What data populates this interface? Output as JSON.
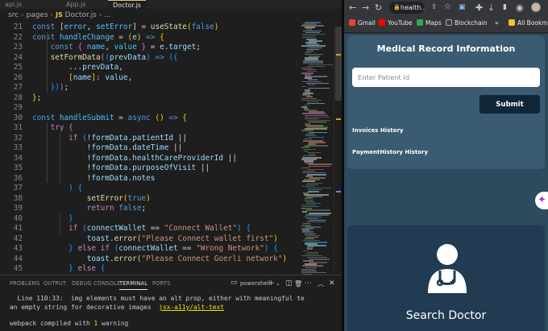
{
  "vscode": {
    "tabs": [
      "api.js",
      "App.js",
      "Doctor.js"
    ],
    "breadcrumb": {
      "parts": [
        "src",
        "pages",
        "Doctor.js"
      ],
      "tail": "..."
    },
    "code_lines": [
      {
        "n": "21",
        "tokens": [
          [
            "kw",
            "const "
          ],
          [
            "pu",
            "["
          ],
          [
            "cst",
            "error"
          ],
          [
            "pu",
            ", "
          ],
          [
            "cst",
            "setError"
          ],
          [
            "pu",
            "] = "
          ],
          [
            "fn",
            "useState"
          ],
          [
            "br1",
            "("
          ],
          [
            "kw",
            "false"
          ],
          [
            "br1",
            ")"
          ]
        ]
      },
      {
        "n": "22",
        "tokens": [
          [
            "kw",
            "const "
          ],
          [
            "cst",
            "handleChange"
          ],
          [
            "pu",
            " = "
          ],
          [
            "br1",
            "("
          ],
          [
            "var",
            "e"
          ],
          [
            "br1",
            ")"
          ],
          [
            "kw",
            " => "
          ],
          [
            "br1",
            "{"
          ]
        ]
      },
      {
        "n": "23",
        "tokens": [
          [
            "kw",
            "    const "
          ],
          [
            "br2",
            "{ "
          ],
          [
            "cst",
            "name"
          ],
          [
            "pu",
            ", "
          ],
          [
            "cst",
            "value"
          ],
          [
            "br2",
            " }"
          ],
          [
            "pu",
            " = "
          ],
          [
            "var",
            "e"
          ],
          [
            "pu",
            "."
          ],
          [
            "var",
            "target"
          ],
          [
            "pu",
            ";"
          ]
        ]
      },
      {
        "n": "24",
        "tokens": [
          [
            "fn",
            "    setFormData"
          ],
          [
            "br2",
            "("
          ],
          [
            "br3",
            "("
          ],
          [
            "var",
            "prevData"
          ],
          [
            "br3",
            ")"
          ],
          [
            "kw",
            " => "
          ],
          [
            "br3",
            "({"
          ]
        ]
      },
      {
        "n": "25",
        "tokens": [
          [
            "pu",
            "        ..."
          ],
          [
            "var",
            "prevData"
          ],
          [
            "pu",
            ","
          ]
        ]
      },
      {
        "n": "26",
        "tokens": [
          [
            "br1",
            "        ["
          ],
          [
            "var",
            "name"
          ],
          [
            "br1",
            "]"
          ],
          [
            "pu",
            ": "
          ],
          [
            "var",
            "value"
          ],
          [
            "pu",
            ","
          ]
        ]
      },
      {
        "n": "27",
        "tokens": [
          [
            "br3",
            "    })"
          ],
          [
            "br2",
            ")"
          ],
          [
            "pu",
            ";"
          ]
        ]
      },
      {
        "n": "28",
        "tokens": [
          [
            "br1",
            "}"
          ],
          [
            "pu",
            ";"
          ]
        ]
      },
      {
        "n": "29",
        "tokens": []
      },
      {
        "n": "30",
        "tokens": [
          [
            "kw",
            "const "
          ],
          [
            "cst",
            "handleSubmit"
          ],
          [
            "pu",
            " = "
          ],
          [
            "kw",
            "async "
          ],
          [
            "br1",
            "()"
          ],
          [
            "kw",
            " => "
          ],
          [
            "br1",
            "{"
          ]
        ]
      },
      {
        "n": "31",
        "tokens": [
          [
            "kw2",
            "    try "
          ],
          [
            "br2",
            "{"
          ]
        ]
      },
      {
        "n": "32",
        "tokens": [
          [
            "kw2",
            "        if "
          ],
          [
            "br3",
            "("
          ],
          [
            "pu",
            "!"
          ],
          [
            "var",
            "formData"
          ],
          [
            "pu",
            "."
          ],
          [
            "var",
            "patientId"
          ],
          [
            "pu",
            " ||"
          ]
        ]
      },
      {
        "n": "33",
        "tokens": [
          [
            "pu",
            "            !"
          ],
          [
            "var",
            "formData"
          ],
          [
            "pu",
            "."
          ],
          [
            "var",
            "dateTime"
          ],
          [
            "pu",
            " ||"
          ]
        ]
      },
      {
        "n": "34",
        "tokens": [
          [
            "pu",
            "            !"
          ],
          [
            "var",
            "formData"
          ],
          [
            "pu",
            "."
          ],
          [
            "var",
            "healthCareProviderId"
          ],
          [
            "pu",
            " ||"
          ]
        ]
      },
      {
        "n": "35",
        "tokens": [
          [
            "pu",
            "            !"
          ],
          [
            "var",
            "formData"
          ],
          [
            "pu",
            "."
          ],
          [
            "var",
            "purposeOfVisit"
          ],
          [
            "pu",
            " ||"
          ]
        ]
      },
      {
        "n": "36",
        "tokens": [
          [
            "pu",
            "            !"
          ],
          [
            "var",
            "formData"
          ],
          [
            "pu",
            "."
          ],
          [
            "var",
            "notes"
          ]
        ]
      },
      {
        "n": "37",
        "tokens": [
          [
            "br3",
            "        ) {"
          ]
        ]
      },
      {
        "n": "38",
        "tokens": [
          [
            "fn",
            "            setError"
          ],
          [
            "br1",
            "("
          ],
          [
            "kw",
            "true"
          ],
          [
            "br1",
            ")"
          ]
        ]
      },
      {
        "n": "39",
        "tokens": [
          [
            "kw2",
            "            return "
          ],
          [
            "kw",
            "false"
          ],
          [
            "pu",
            ";"
          ]
        ]
      },
      {
        "n": "40",
        "tokens": [
          [
            "br3",
            "        }"
          ]
        ]
      },
      {
        "n": "41",
        "tokens": [
          [
            "kw2",
            "        if "
          ],
          [
            "br3",
            "("
          ],
          [
            "var",
            "connectWallet"
          ],
          [
            "pu",
            " == "
          ],
          [
            "str",
            "\"Connect Wallet\""
          ],
          [
            "br3",
            ")"
          ],
          [
            "br3",
            " {"
          ]
        ]
      },
      {
        "n": "42",
        "tokens": [
          [
            "var",
            "            toast"
          ],
          [
            "pu",
            "."
          ],
          [
            "fn",
            "error"
          ],
          [
            "br1",
            "("
          ],
          [
            "str",
            "\"Please Connect wallet first\""
          ],
          [
            "br1",
            ")"
          ]
        ]
      },
      {
        "n": "43",
        "tokens": [
          [
            "br3",
            "        } "
          ],
          [
            "kw2",
            "else if "
          ],
          [
            "br3",
            "("
          ],
          [
            "var",
            "connectWallet"
          ],
          [
            "pu",
            " == "
          ],
          [
            "str",
            "\"Wrong Network\""
          ],
          [
            "br3",
            ")"
          ],
          [
            "br3",
            " {"
          ]
        ]
      },
      {
        "n": "44",
        "tokens": [
          [
            "var",
            "            toast"
          ],
          [
            "pu",
            "."
          ],
          [
            "fn",
            "error"
          ],
          [
            "br1",
            "("
          ],
          [
            "str",
            "\"Please Connect Goerli network\""
          ],
          [
            "br1",
            ")"
          ]
        ]
      },
      {
        "n": "45",
        "tokens": [
          [
            "br3",
            "        } "
          ],
          [
            "kw2",
            "else "
          ],
          [
            "br3",
            "{"
          ]
        ]
      },
      {
        "n": "46",
        "tokens": [
          [
            "fn",
            "            setLoading"
          ],
          [
            "br1",
            "("
          ],
          [
            "kw",
            "true"
          ],
          [
            "br1",
            ")"
          ]
        ]
      }
    ],
    "panel": {
      "tabs": [
        "PROBLEMS",
        "OUTPUT",
        "DEBUG CONSOLE",
        "TERMINAL",
        "PORTS"
      ],
      "active_tab": "TERMINAL",
      "shell": "powershell",
      "terminal_lines": {
        "l1_prefix": "  Line 110:33:  ",
        "l1_msg": "img elements must have an alt prop, either with meaningful te",
        "l2_msg": "an empty string for decorative images  ",
        "l2_rule": "jsx-a11y/alt-text",
        "l3_prefix": "webpack compiled with ",
        "l3_count": "1",
        "l3_suffix": " warning"
      }
    }
  },
  "browser": {
    "url": "health...",
    "bookmarks": [
      {
        "label": "Gmail",
        "color": "#ea4335"
      },
      {
        "label": "YouTube",
        "color": "#ff0000"
      },
      {
        "label": "Maps",
        "color": "#34a853"
      },
      {
        "label": "Blockchain",
        "color": "#3c3c3c"
      },
      {
        "label": "All Bookmar",
        "color": "#f1c232"
      }
    ],
    "more_bookmarks": "»",
    "page": {
      "card_title": "Medical Record Information",
      "patient_placeholder": "Enter Patient Id",
      "submit_label": "Submit",
      "links": [
        "Invoices History",
        "PaymentHistory History"
      ],
      "doctor_label": "Search Doctor"
    }
  }
}
